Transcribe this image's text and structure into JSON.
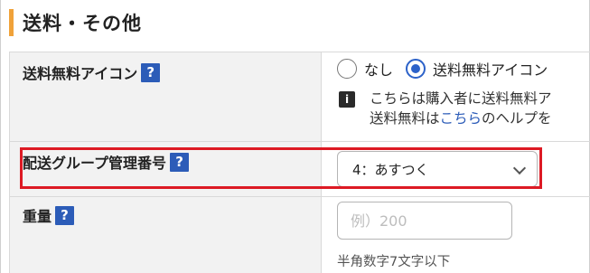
{
  "section": {
    "title": "送料・その他"
  },
  "colors": {
    "accent_bar": "#f0a23a",
    "help_icon": "#2c5cb8",
    "radio_selected": "#2c62c9",
    "highlight": "#dd1a24",
    "link": "#2c5cb8"
  },
  "fields": {
    "shipping_icon": {
      "label": "送料無料アイコン",
      "help": "?",
      "options": [
        {
          "label": "なし",
          "selected": false
        },
        {
          "label": "送料無料アイコン",
          "selected": true
        }
      ],
      "info_icon": "i",
      "info_line1": "こちらは購入者に送料無料ア",
      "info_line2_prefix": "送料無料は",
      "info_link": "こちら",
      "info_line2_suffix": "のヘルプを"
    },
    "delivery_group": {
      "label": "配送グループ管理番号",
      "help": "?",
      "selected_value": "4：あすつく",
      "icon": "chevron-down-icon"
    },
    "weight": {
      "label": "重量",
      "help": "?",
      "placeholder": "例）200",
      "value": "",
      "hint": "半角数字7文字以下"
    }
  }
}
